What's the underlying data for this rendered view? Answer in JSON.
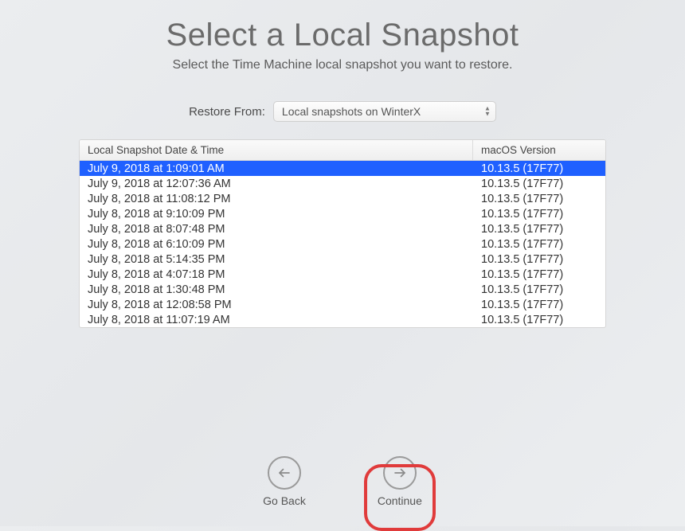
{
  "title": "Select a Local Snapshot",
  "subtitle": "Select the Time Machine local snapshot you want to restore.",
  "restore": {
    "label": "Restore From:",
    "value": "Local snapshots on WinterX"
  },
  "table": {
    "headers": {
      "date": "Local Snapshot Date & Time",
      "version": "macOS Version"
    },
    "rows": [
      {
        "date": "July 9, 2018 at 1:09:01 AM",
        "version": "10.13.5 (17F77)",
        "selected": true
      },
      {
        "date": "July 9, 2018 at 12:07:36 AM",
        "version": "10.13.5 (17F77)",
        "selected": false
      },
      {
        "date": "July 8, 2018 at 11:08:12 PM",
        "version": "10.13.5 (17F77)",
        "selected": false
      },
      {
        "date": "July 8, 2018 at 9:10:09 PM",
        "version": "10.13.5 (17F77)",
        "selected": false
      },
      {
        "date": "July 8, 2018 at 8:07:48 PM",
        "version": "10.13.5 (17F77)",
        "selected": false
      },
      {
        "date": "July 8, 2018 at 6:10:09 PM",
        "version": "10.13.5 (17F77)",
        "selected": false
      },
      {
        "date": "July 8, 2018 at 5:14:35 PM",
        "version": "10.13.5 (17F77)",
        "selected": false
      },
      {
        "date": "July 8, 2018 at 4:07:18 PM",
        "version": "10.13.5 (17F77)",
        "selected": false
      },
      {
        "date": "July 8, 2018 at 1:30:48 PM",
        "version": "10.13.5 (17F77)",
        "selected": false
      },
      {
        "date": "July 8, 2018 at 12:08:58 PM",
        "version": "10.13.5 (17F77)",
        "selected": false
      },
      {
        "date": "July 8, 2018 at 11:07:19 AM",
        "version": "10.13.5 (17F77)",
        "selected": false
      }
    ]
  },
  "buttons": {
    "back": "Go Back",
    "continue": "Continue"
  }
}
